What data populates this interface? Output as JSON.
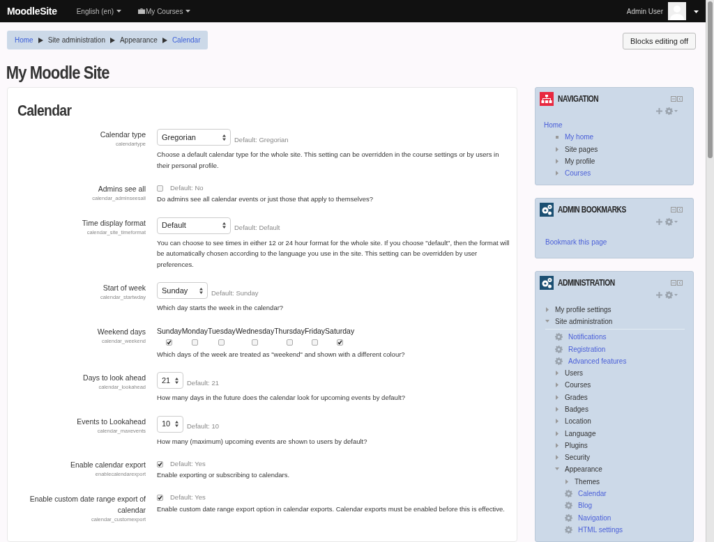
{
  "topbar": {
    "brand": "MoodleSite",
    "menus": [
      {
        "label": "English (en)"
      },
      {
        "label": "My Courses"
      }
    ],
    "user": "Admin User"
  },
  "breadcrumb": [
    {
      "label": "Home",
      "link": true
    },
    {
      "label": "Site administration",
      "link": false
    },
    {
      "label": "Appearance",
      "link": false
    },
    {
      "label": "Calendar",
      "link": true
    }
  ],
  "editing_button": "Blocks editing off",
  "site_title": "My Moodle Site",
  "page_heading": "Calendar",
  "settings": [
    {
      "kind": "select",
      "label": "Calendar type",
      "key": "calendartype",
      "value": "Gregorian",
      "default": "Default: Gregorian",
      "description": "Choose a default calendar type for the whole site. This setting can be overridden in the course settings or by users in their personal profile."
    },
    {
      "kind": "checkbox",
      "label": "Admins see all",
      "key": "calendar_adminseesall",
      "checked": false,
      "default": "Default: No",
      "description": "Do admins see all calendar events or just those that apply to themselves?"
    },
    {
      "kind": "select",
      "label": "Time display format",
      "key": "calendar_site_timeformat",
      "value": "Default",
      "default": "Default: Default",
      "description": "You can choose to see times in either 12 or 24 hour format for the whole site. If you choose \"default\", then the format will be automatically chosen according to the language you use in the site. This setting can be overridden by user preferences."
    },
    {
      "kind": "select",
      "label": "Start of week",
      "key": "calendar_startwday",
      "value": "Sunday",
      "default": "Default: Sunday",
      "description": "Which day starts the week in the calendar?"
    },
    {
      "kind": "weekdays",
      "label": "Weekend days",
      "key": "calendar_weekend",
      "days": [
        {
          "label": "Sunday",
          "checked": true
        },
        {
          "label": "Monday",
          "checked": false
        },
        {
          "label": "Tuesday",
          "checked": false
        },
        {
          "label": "Wednesday",
          "checked": false
        },
        {
          "label": "Thursday",
          "checked": false
        },
        {
          "label": "Friday",
          "checked": false
        },
        {
          "label": "Saturday",
          "checked": true
        }
      ],
      "description": "Which days of the week are treated as \"weekend\" and shown with a different colour?"
    },
    {
      "kind": "select",
      "label": "Days to look ahead",
      "key": "calendar_lookahead",
      "value": "21",
      "default": "Default: 21",
      "description": "How many days in the future does the calendar look for upcoming events by default?"
    },
    {
      "kind": "select",
      "label": "Events to Lookahead",
      "key": "calendar_maxevents",
      "value": "10",
      "default": "Default: 10",
      "description": "How many (maximum) upcoming events are shown to users by default?"
    },
    {
      "kind": "checkbox",
      "label": "Enable calendar export",
      "key": "enablecalendarexport",
      "checked": true,
      "default": "Default: Yes",
      "description": "Enable exporting or subscribing to calendars."
    },
    {
      "kind": "checkbox",
      "label": "Enable custom date range export of calendar",
      "key": "calendar_customexport",
      "checked": true,
      "default": "Default: Yes",
      "description": "Enable custom date range export option in calendar exports. Calendar exports must be enabled before this is effective."
    }
  ],
  "blocks": [
    {
      "title": "NAVIGATION",
      "tree": [
        {
          "label": "Home",
          "kind": "root",
          "link": true,
          "children": [
            {
              "label": "My home",
              "kind": "bullet",
              "link": true
            },
            {
              "label": "Site pages",
              "kind": "folder",
              "expanded": false,
              "link": false
            },
            {
              "label": "My profile",
              "kind": "folder",
              "expanded": false,
              "link": false
            },
            {
              "label": "Courses",
              "kind": "folder",
              "expanded": false,
              "link": true
            }
          ]
        }
      ]
    },
    {
      "title": "ADMIN BOOKMARKS",
      "links": [
        "Bookmark this page"
      ]
    },
    {
      "title": "ADMINISTRATION",
      "tree": [
        {
          "label": "My profile settings",
          "kind": "folder",
          "expanded": false,
          "link": false
        },
        {
          "label": "Site administration",
          "kind": "folder",
          "expanded": true,
          "link": false,
          "divider": true,
          "children": [
            {
              "label": "Notifications",
              "kind": "setting",
              "link": true
            },
            {
              "label": "Registration",
              "kind": "setting",
              "link": true
            },
            {
              "label": "Advanced features",
              "kind": "setting",
              "link": true
            },
            {
              "label": "Users",
              "kind": "folder",
              "expanded": false,
              "link": false
            },
            {
              "label": "Courses",
              "kind": "folder",
              "expanded": false,
              "link": false
            },
            {
              "label": "Grades",
              "kind": "folder",
              "expanded": false,
              "link": false
            },
            {
              "label": "Badges",
              "kind": "folder",
              "expanded": false,
              "link": false
            },
            {
              "label": "Location",
              "kind": "folder",
              "expanded": false,
              "link": false
            },
            {
              "label": "Language",
              "kind": "folder",
              "expanded": false,
              "link": false
            },
            {
              "label": "Plugins",
              "kind": "folder",
              "expanded": false,
              "link": false
            },
            {
              "label": "Security",
              "kind": "folder",
              "expanded": false,
              "link": false
            },
            {
              "label": "Appearance",
              "kind": "folder",
              "expanded": true,
              "link": false,
              "children": [
                {
                  "label": "Themes",
                  "kind": "folder",
                  "expanded": false,
                  "link": false
                },
                {
                  "label": "Calendar",
                  "kind": "setting",
                  "link": true
                },
                {
                  "label": "Blog",
                  "kind": "setting",
                  "link": true
                },
                {
                  "label": "Navigation",
                  "kind": "setting",
                  "link": true
                },
                {
                  "label": "HTML settings",
                  "kind": "setting",
                  "link": true
                }
              ]
            }
          ]
        }
      ]
    }
  ]
}
